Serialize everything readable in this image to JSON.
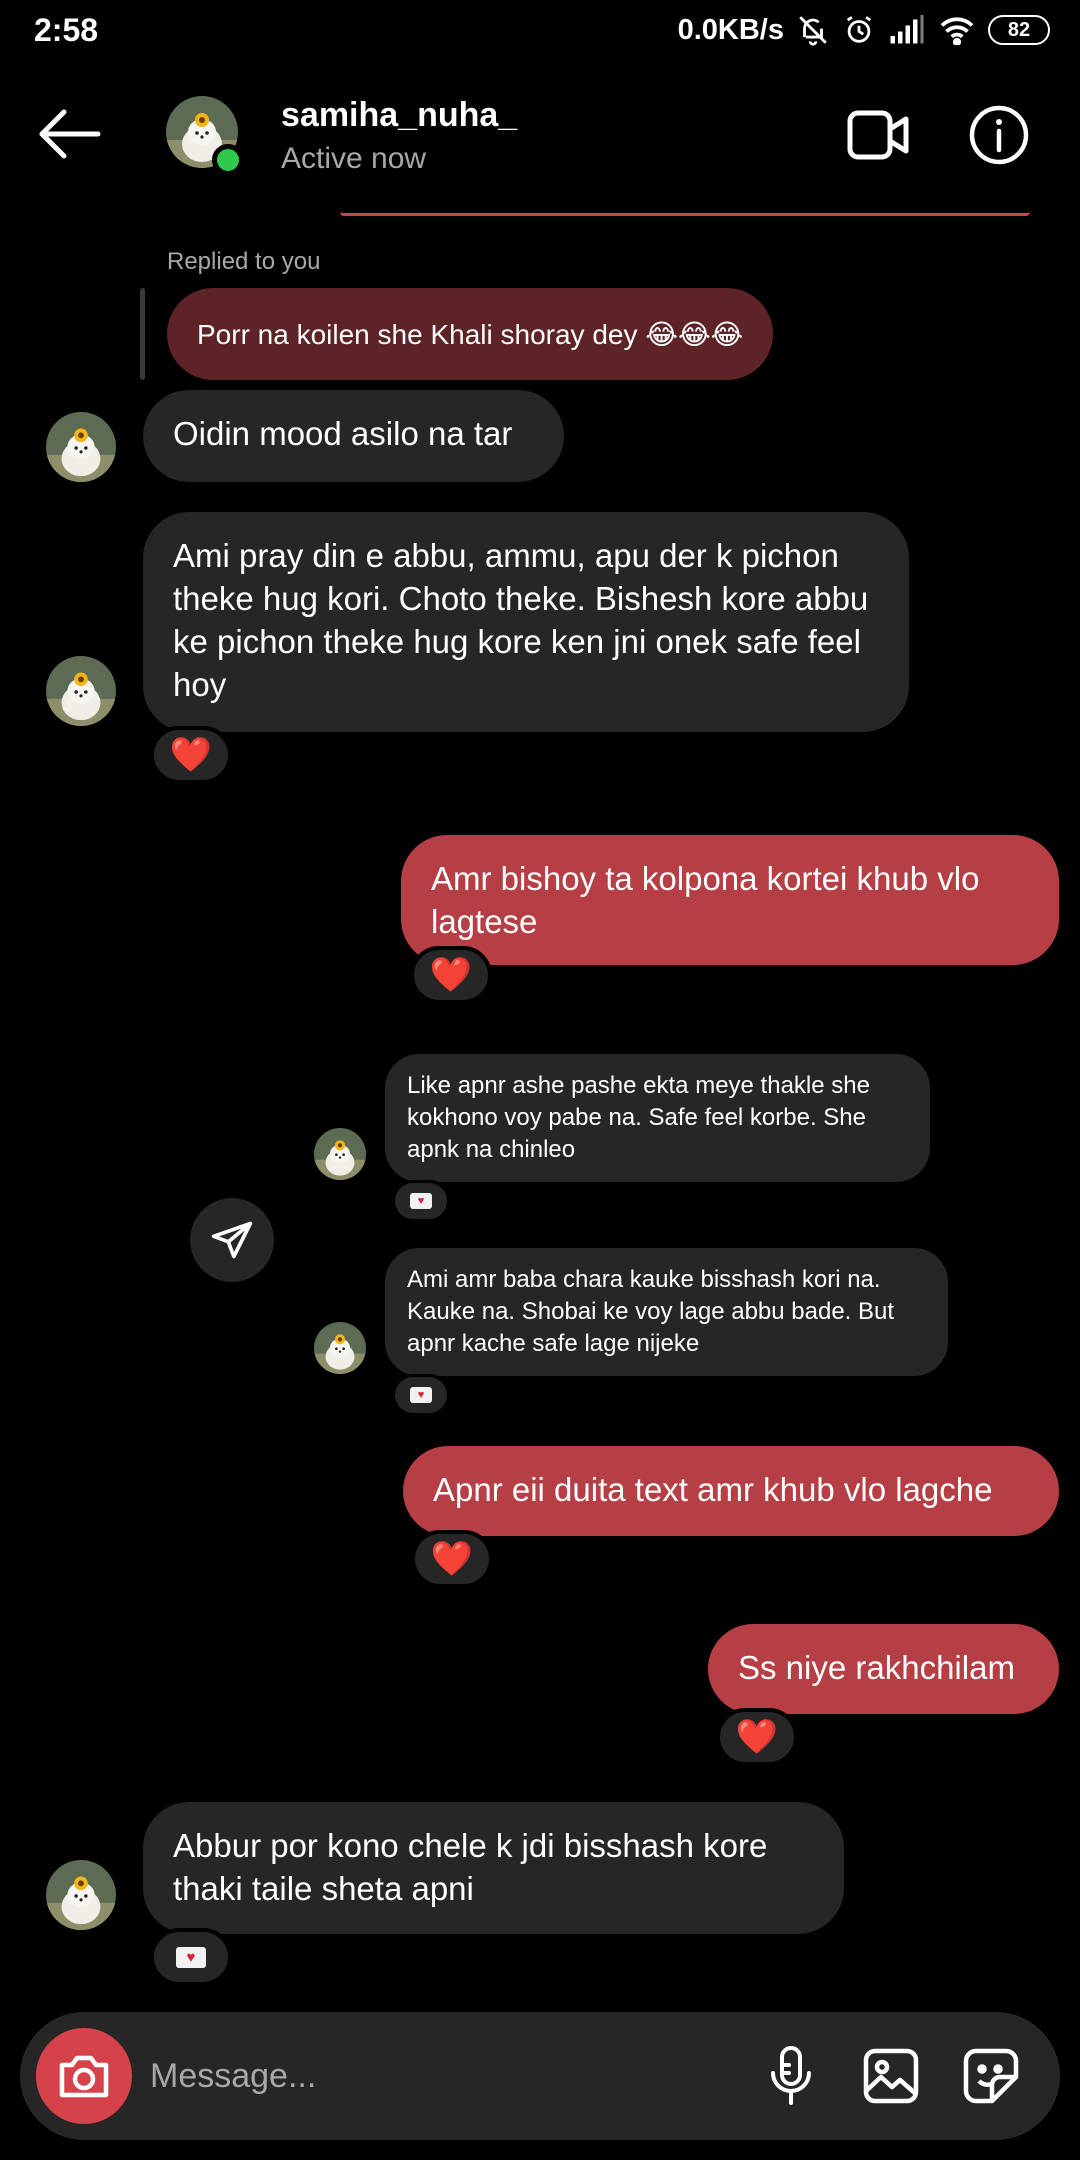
{
  "status_bar": {
    "time": "2:58",
    "net_speed": "0.0KB/s",
    "battery": "82"
  },
  "header": {
    "username": "samiha_nuha_",
    "status": "Active now"
  },
  "reply": {
    "label": "Replied to you",
    "text": "Porr na koilen she Khali shoray dey 😂😂😂"
  },
  "messages": [
    {
      "from": "them",
      "text": "Oidin mood asilo na tar"
    },
    {
      "from": "them",
      "text": "Ami pray din e abbu, ammu, apu der k pichon theke hug kori. Choto theke. Bishesh kore abbu ke pichon theke hug kore ken jni onek safe feel hoy",
      "reaction": "❤️"
    },
    {
      "from": "me",
      "text": "Amr bishoy ta kolpona kortei khub vlo lagtese",
      "reaction": "❤️"
    },
    {
      "from": "them",
      "text": "Like apnr ashe pashe ekta meye thakle she kokhono voy pabe na. Safe feel korbe. She apnk na chinleo",
      "reaction": "💌"
    },
    {
      "from": "them",
      "text": "Ami amr baba chara kauke bisshash kori na. Kauke na. Shobai ke voy lage abbu bade. But apnr kache safe lage nijeke",
      "reaction": "💌"
    },
    {
      "from": "me",
      "text": "Apnr eii duita text amr khub vlo lagche",
      "reaction": "❤️"
    },
    {
      "from": "me",
      "text": "Ss niye rakhchilam",
      "reaction": "❤️"
    },
    {
      "from": "them",
      "text": "Abbur por kono chele k jdi bisshash kore thaki taile sheta apni",
      "reaction": "💌"
    }
  ],
  "composer": {
    "placeholder": "Message..."
  },
  "colors": {
    "outgoing_bubble": "#b53f45",
    "incoming_bubble": "#262626",
    "reply_bubble": "#5e2327",
    "online": "#2fc94b",
    "camera_button": "#d6424a"
  }
}
